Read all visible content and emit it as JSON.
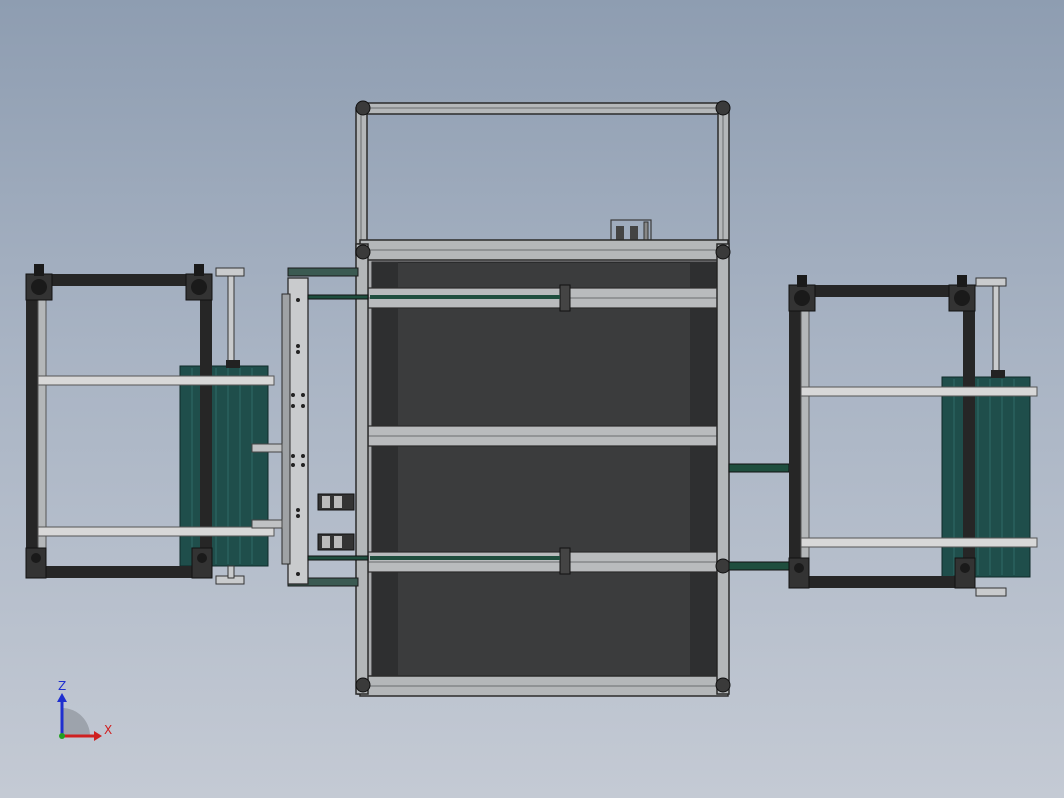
{
  "viewport": {
    "background_top": "#8e9db1",
    "background_bottom": "#c4cad4"
  },
  "model": {
    "colors": {
      "frame_profile": "#b4b7b9",
      "frame_edge": "#2b2b2b",
      "panel_dark": "#3b3c3d",
      "roller_teal": "#1f4e4b",
      "dark_beam": "#262626",
      "shaft": "#d8d8d8"
    }
  },
  "triad": {
    "z_label": "Z",
    "x_label": "X",
    "colors": {
      "z": "#1f2fcf",
      "x": "#cf2020",
      "y": "#20a020"
    }
  }
}
